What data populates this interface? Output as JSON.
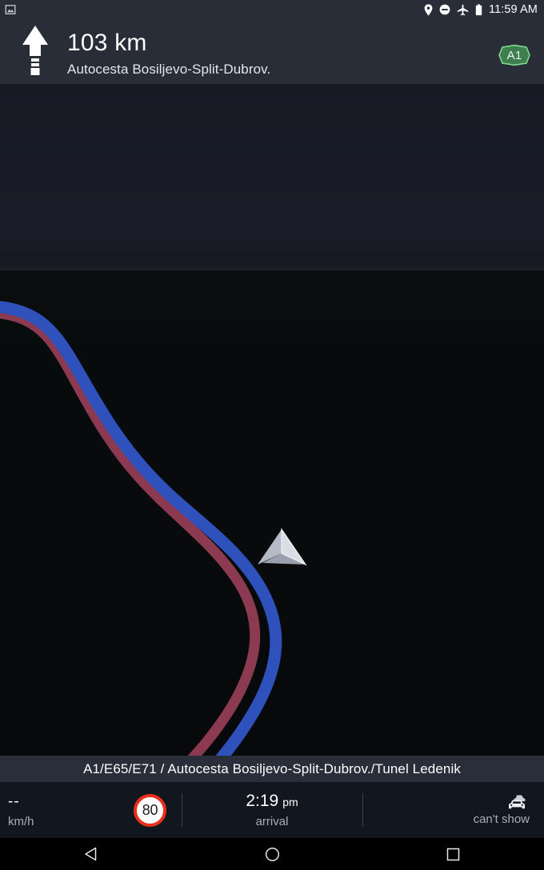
{
  "statusbar": {
    "notification_icon": "screenshot-image-icon",
    "icons": [
      "location-pin-icon",
      "do-not-disturb-icon",
      "airplane-mode-icon",
      "battery-icon"
    ],
    "clock": "11:59 AM"
  },
  "header": {
    "maneuver_icon": "straight-ahead-arrow-icon",
    "distance": "103 km",
    "road_name": "Autocesta Bosiljevo-Split-Dubrov.",
    "shield": {
      "label": "A1",
      "icon": "road-shield-hexagon-icon",
      "color": "#4a8f5a"
    }
  },
  "map": {
    "route_color": "#2f51bb",
    "alternate_route_color": "#8b3a52",
    "position_marker_icon": "navigation-chevron-icon",
    "sky_color": "#191c28",
    "ground_color": "#080b0c"
  },
  "street_bar": {
    "label": "A1/E65/E71 / Autocesta Bosiljevo-Split-Dubrov./Tunel Ledenik"
  },
  "dashboard": {
    "speed": {
      "value": "--",
      "unit": "km/h"
    },
    "speed_limit": {
      "value": "80",
      "icon": "speed-limit-sign-icon",
      "ring_color": "#e8301c"
    },
    "arrival": {
      "time": "2:19",
      "ampm": "pm",
      "label": "arrival"
    },
    "traffic": {
      "icon": "traffic-cars-icon",
      "label": "can't show"
    }
  },
  "navbar": {
    "back": "back-triangle-icon",
    "home": "home-circle-icon",
    "recents": "recents-square-icon"
  }
}
